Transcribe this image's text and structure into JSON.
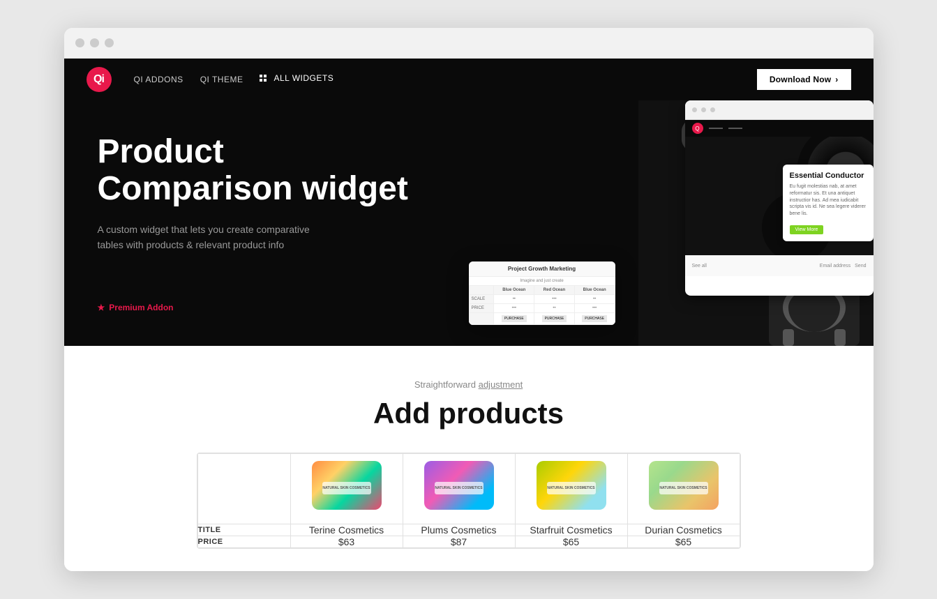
{
  "browser": {
    "dots": [
      "dot1",
      "dot2",
      "dot3"
    ]
  },
  "header": {
    "logo_text": "Qi",
    "nav": [
      {
        "label": "QI ADDONS",
        "active": false
      },
      {
        "label": "QI THEME",
        "active": false
      },
      {
        "label": "ALL WIDGETS",
        "active": true,
        "has_icon": true
      }
    ],
    "download_btn": "Download Now"
  },
  "hero": {
    "title_line1": "Product",
    "title_line2": "Comparison widget",
    "description": "A custom widget that lets you create comparative tables with products & relevant product info",
    "premium_label": "Premium Addon",
    "mock_table": {
      "title": "Project Growth Marketing",
      "subtitle": "Imagine and just create",
      "columns": [
        "",
        "Blue Ocean",
        "Red Ocean",
        "Blue Ocean"
      ],
      "rows": [
        {
          "label": "SCALE",
          "values": [
            "••",
            "•••",
            "••",
            "•••"
          ]
        },
        {
          "label": "PRICE",
          "values": [
            "•••",
            "••",
            "•••",
            "••"
          ]
        }
      ],
      "buy_label": "PURCHASE"
    },
    "right_card": {
      "title": "Essential Conductor",
      "body": "Eu fugit molestias nab, at amet reformatur sis. Et una antiquet instructior has. Ad mea iudicabit scripta vis id. Ne sea legere viderer bene lis.",
      "btn": "View More"
    }
  },
  "section": {
    "eyebrow_plain": "Straightforward",
    "eyebrow_underline": "adjustment",
    "title": "Add products",
    "table": {
      "columns": [
        {
          "id": "label_col",
          "title": ""
        },
        {
          "id": "terine",
          "title": "Terine Cosmetics",
          "price": "$63",
          "img_class": "img-terine"
        },
        {
          "id": "plums",
          "title": "Plums Cosmetics",
          "price": "$87",
          "img_class": "img-plums"
        },
        {
          "id": "starfruit",
          "title": "Starfruit Cosmetics",
          "price": "$65",
          "img_class": "img-starfruit"
        },
        {
          "id": "durian",
          "title": "Durian Cosmetics",
          "price": "$65",
          "img_class": "img-durian"
        }
      ],
      "rows": [
        {
          "label": "TITLE",
          "key": "title"
        },
        {
          "label": "PRICE",
          "key": "price"
        }
      ]
    }
  },
  "colors": {
    "accent": "#e8194b",
    "dark_bg": "#0a0a0a",
    "text_muted": "#999"
  }
}
